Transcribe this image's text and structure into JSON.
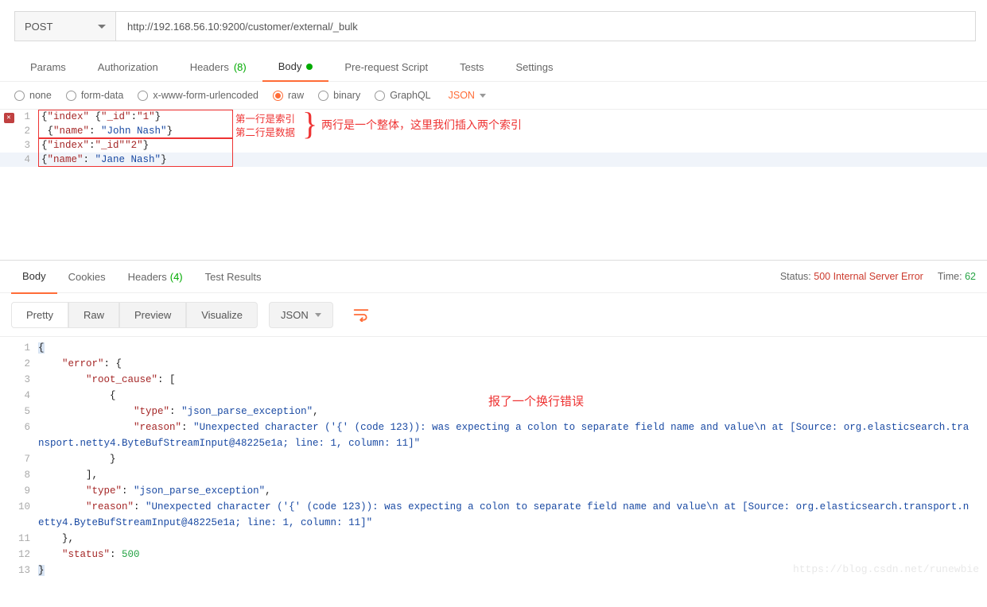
{
  "request": {
    "method": "POST",
    "url": "http://192.168.56.10:9200/customer/external/_bulk"
  },
  "tabs": {
    "params": "Params",
    "authorization": "Authorization",
    "headers": "Headers",
    "headers_count": "(8)",
    "body": "Body",
    "prerequest": "Pre-request Script",
    "tests": "Tests",
    "settings": "Settings"
  },
  "body_types": {
    "none": "none",
    "formdata": "form-data",
    "xwww": "x-www-form-urlencoded",
    "raw": "raw",
    "binary": "binary",
    "graphql": "GraphQL",
    "format": "JSON"
  },
  "request_body_lines": [
    {
      "no": "1",
      "tokens": [
        [
          "punc",
          "{"
        ],
        [
          "key",
          "\"index\""
        ],
        [
          "punc",
          " {"
        ],
        [
          "key",
          "\"_id\""
        ],
        [
          "punc",
          ":"
        ],
        [
          "key",
          "\"1\""
        ],
        [
          "punc",
          "}"
        ]
      ]
    },
    {
      "no": "2",
      "tokens": [
        [
          "punc",
          " {"
        ],
        [
          "key",
          "\"name\""
        ],
        [
          "punc",
          ": "
        ],
        [
          "str",
          "\"John Nash\""
        ],
        [
          "punc",
          "}"
        ]
      ]
    },
    {
      "no": "3",
      "tokens": [
        [
          "punc",
          "{"
        ],
        [
          "key",
          "\"index\""
        ],
        [
          "punc",
          ":"
        ],
        [
          "key",
          "\"_id\""
        ],
        [
          "key",
          "\"2\""
        ],
        [
          "punc",
          "}"
        ]
      ]
    },
    {
      "no": "4",
      "tokens": [
        [
          "punc",
          "{"
        ],
        [
          "key",
          "\"name\""
        ],
        [
          "punc",
          ": "
        ],
        [
          "str",
          "\"Jane Nash\""
        ],
        [
          "punc",
          "}"
        ]
      ]
    }
  ],
  "annotations": {
    "line1": "第一行是索引",
    "line2": "第二行是数据",
    "right": "两行是一个整体，这里我们插入两个索引",
    "resp_err": "报了一个换行错误"
  },
  "response": {
    "tabs": {
      "body": "Body",
      "cookies": "Cookies",
      "headers": "Headers",
      "headers_count": "(4)",
      "testresults": "Test Results"
    },
    "status_label": "Status:",
    "status_value": "500 Internal Server Error",
    "time_label": "Time:",
    "time_value": "62",
    "viewbuttons": {
      "pretty": "Pretty",
      "raw": "Raw",
      "preview": "Preview",
      "visualize": "Visualize"
    },
    "format": "JSON"
  },
  "response_body_lines": [
    {
      "no": "1",
      "indent": 0,
      "tokens": [
        [
          "punc",
          "{"
        ]
      ]
    },
    {
      "no": "2",
      "indent": 4,
      "tokens": [
        [
          "key",
          "\"error\""
        ],
        [
          "punc",
          ": {"
        ]
      ]
    },
    {
      "no": "3",
      "indent": 8,
      "tokens": [
        [
          "key",
          "\"root_cause\""
        ],
        [
          "punc",
          ": ["
        ]
      ]
    },
    {
      "no": "4",
      "indent": 12,
      "tokens": [
        [
          "punc",
          "{"
        ]
      ]
    },
    {
      "no": "5",
      "indent": 16,
      "tokens": [
        [
          "key",
          "\"type\""
        ],
        [
          "punc",
          ": "
        ],
        [
          "str",
          "\"json_parse_exception\""
        ],
        [
          "punc",
          ","
        ]
      ]
    },
    {
      "no": "6",
      "indent": 16,
      "tokens": [
        [
          "key",
          "\"reason\""
        ],
        [
          "punc",
          ": "
        ],
        [
          "str",
          "\"Unexpected character ('{' (code 123)): was expecting a colon to separate field name and value\\n at [Source: org.elasticsearch.transport.netty4.ByteBufStreamInput@48225e1a; line: 1, column: 11]\""
        ]
      ]
    },
    {
      "no": "7",
      "indent": 12,
      "tokens": [
        [
          "punc",
          "}"
        ]
      ]
    },
    {
      "no": "8",
      "indent": 8,
      "tokens": [
        [
          "punc",
          "],"
        ]
      ]
    },
    {
      "no": "9",
      "indent": 8,
      "tokens": [
        [
          "key",
          "\"type\""
        ],
        [
          "punc",
          ": "
        ],
        [
          "str",
          "\"json_parse_exception\""
        ],
        [
          "punc",
          ","
        ]
      ]
    },
    {
      "no": "10",
      "indent": 8,
      "tokens": [
        [
          "key",
          "\"reason\""
        ],
        [
          "punc",
          ": "
        ],
        [
          "str",
          "\"Unexpected character ('{' (code 123)): was expecting a colon to separate field name and value\\n at [Source: org.elasticsearch.transport.netty4.ByteBufStreamInput@48225e1a; line: 1, column: 11]\""
        ]
      ]
    },
    {
      "no": "11",
      "indent": 4,
      "tokens": [
        [
          "punc",
          "},"
        ]
      ]
    },
    {
      "no": "12",
      "indent": 4,
      "tokens": [
        [
          "key",
          "\"status\""
        ],
        [
          "punc",
          ": "
        ],
        [
          "num",
          "500"
        ]
      ]
    },
    {
      "no": "13",
      "indent": 0,
      "tokens": [
        [
          "punc",
          "}"
        ]
      ]
    }
  ],
  "watermark": "https://blog.csdn.net/runewbie"
}
